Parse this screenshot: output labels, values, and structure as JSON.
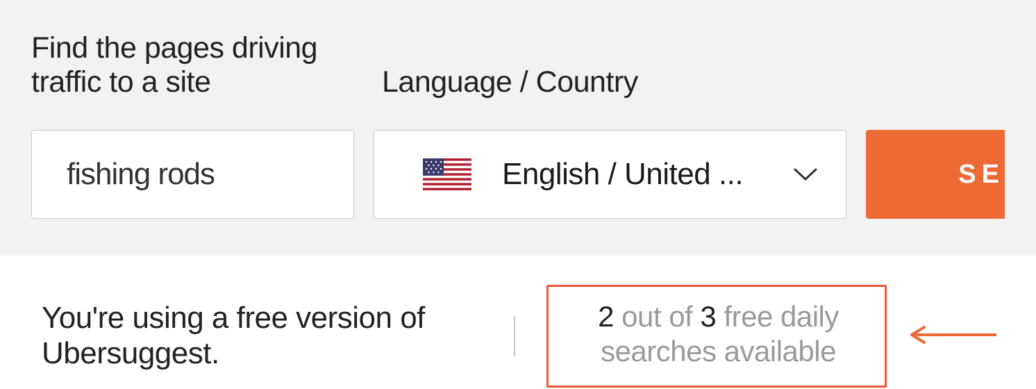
{
  "labels": {
    "site": "Find the pages driving traffic to a site",
    "lang": "Language / Country"
  },
  "inputs": {
    "site_value": "fishing rods",
    "lang_value": "English / United ..."
  },
  "search_label": "SE",
  "free_version_text": "You're using a free version of Ubersuggest.",
  "quota": {
    "used": "2",
    "mid": " out of ",
    "total": "3",
    "tail": " free daily searches available"
  },
  "colors": {
    "accent": "#ed6a35",
    "highlight_border": "#ee5735"
  }
}
